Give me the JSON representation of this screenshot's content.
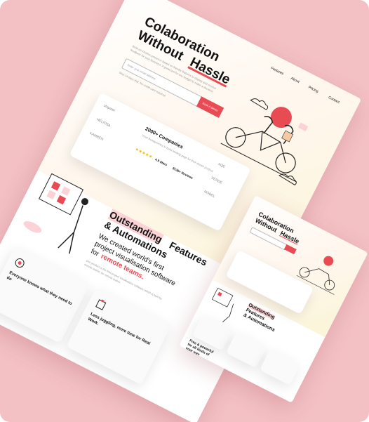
{
  "colors": {
    "background": "#f3c0c4",
    "accent": "#e94b55",
    "highlight": "#fbd3d6",
    "text": "#111111",
    "hero_bg": "#fbf5d8"
  },
  "nav": {
    "items": [
      "Features",
      "About",
      "Pricing",
      "Contact"
    ]
  },
  "hero": {
    "title_line1": "Colaboration",
    "title_line2_prefix": "Without",
    "title_line2_highlight": "Hassle",
    "description": "Build an intuitive presence based on friendly features to display and receive feedback for your Business. A great tool for any budget to make a decision.",
    "email_placeholder": "Enter your email address",
    "cta_label": "Book A Demo",
    "note": "Stop 14 days trial. No credit card required."
  },
  "companies": {
    "headline": "2000+ Companies",
    "subline": "Trust Bumpjourney to build landing page for their dream product",
    "stars": "★★★★★",
    "rating_value": "4.9 Stars",
    "reviews": "8130+ Reviews",
    "logos": [
      "shipster",
      "HELIOSA",
      "KAMBEN",
      "AQE",
      "VERDE",
      "NOBEL"
    ]
  },
  "features": {
    "title_highlight": "Outstanding",
    "title_rest_line1": "Features",
    "title_line2": "& Automations",
    "subtitle_line1": "We created world's first",
    "subtitle_line2": "project visualisation software",
    "subtitle_line3_prefix": "for",
    "subtitle_line3_highlight": "remote teams.",
    "body": "Our product is the first project visualisation software which is built by remote teams, for remote teams.",
    "cards": [
      {
        "title": "Everyone knows what they need to do",
        "icon": "target-icon"
      },
      {
        "title": "Less juggling, more time for Real Work.",
        "icon": "clipboard-icon"
      }
    ]
  },
  "mini": {
    "title_line1": "Colaboration",
    "title_line2_prefix": "Without",
    "title_line2_highlight": "Hassle",
    "features_title_line1": "Outstanding",
    "features_title_line2": "Features",
    "features_title_line3": "& Automations",
    "footer_line1": "Free & powerful",
    "footer_line2": "for all kinds of",
    "footer_line3": "your way"
  }
}
